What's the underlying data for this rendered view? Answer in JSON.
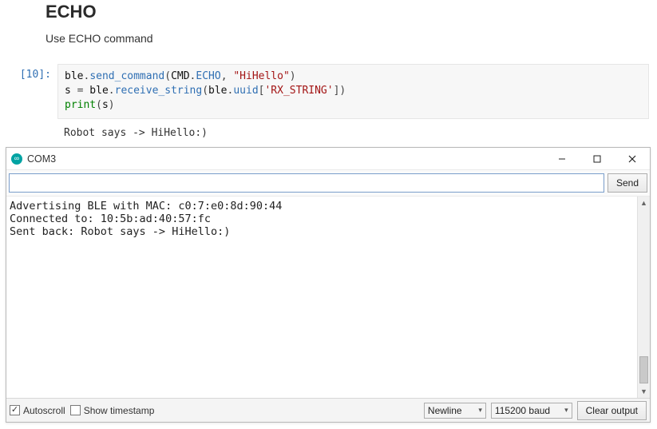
{
  "notebook": {
    "heading": "ECHO",
    "subheading": "Use ECHO command",
    "prompt": "[10]:",
    "code": {
      "l1_v1": "ble",
      "l1_p1": ".",
      "l1_a1": "send_command",
      "l1_p2": "(",
      "l1_v2": "CMD",
      "l1_p3": ".",
      "l1_a2": "ECHO",
      "l1_p4": ", ",
      "l1_s1": "\"HiHello\"",
      "l1_p5": ")",
      "l2_v1": "s ",
      "l2_p1": "=",
      "l2_v2": " ble",
      "l2_p2": ".",
      "l2_a1": "receive_string",
      "l2_p3": "(",
      "l2_v3": "ble",
      "l2_p4": ".",
      "l2_a2": "uuid",
      "l2_p5": "[",
      "l2_s1": "'RX_STRING'",
      "l2_p6": "])",
      "l3_k1": "print",
      "l3_p1": "(",
      "l3_v1": "s",
      "l3_p2": ")"
    },
    "output": "Robot says -> HiHello:)"
  },
  "window": {
    "title": "COM3",
    "send_input_value": "",
    "send_input_placeholder": "",
    "send_button": "Send",
    "terminal_lines": [
      "Advertising BLE with MAC: c0:7:e0:8d:90:44",
      "Connected to: 10:5b:ad:40:57:fc",
      "Sent back: Robot says -> HiHello:)"
    ],
    "autoscroll_label": "Autoscroll",
    "autoscroll_checked": true,
    "timestamp_label": "Show timestamp",
    "timestamp_checked": false,
    "line_ending_selected": "Newline",
    "baud_selected": "115200 baud",
    "clear_button": "Clear output"
  }
}
